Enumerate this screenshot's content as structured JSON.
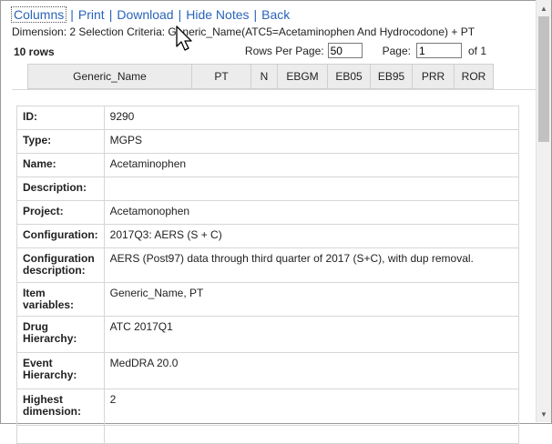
{
  "toolbar": {
    "columns": "Columns",
    "print": "Print",
    "download": "Download",
    "hide_notes": "Hide Notes",
    "back": "Back",
    "separator": "|"
  },
  "criteria": "Dimension: 2 Selection Criteria: Generic_Name(ATC5=Acetaminophen And Hydrocodone) + PT",
  "rows_count": "10 rows",
  "pager": {
    "rows_per_page_label": "Rows Per Page:",
    "rows_per_page_value": "50",
    "page_label": "Page:",
    "page_value": "1",
    "of_label": "of 1"
  },
  "columns": [
    "Generic_Name",
    "PT",
    "N",
    "EBGM",
    "EB05",
    "EB95",
    "PRR",
    "ROR"
  ],
  "details": [
    {
      "key": "ID:",
      "value": "9290"
    },
    {
      "key": "Type:",
      "value": "MGPS"
    },
    {
      "key": "Name:",
      "value": "Acetaminophen"
    },
    {
      "key": "Description:",
      "value": ""
    },
    {
      "key": "Project:",
      "value": "Acetamonophen"
    },
    {
      "key": "Configuration:",
      "value": "2017Q3: AERS (S + C)"
    },
    {
      "key": "Configuration description:",
      "value": "AERS (Post97) data through third quarter of 2017 (S+C), with dup removal."
    },
    {
      "key": "Item variables:",
      "value": "Generic_Name, PT"
    },
    {
      "key": "Drug Hierarchy:",
      "value": "ATC 2017Q1"
    },
    {
      "key": "Event Hierarchy:",
      "value": "MedDRA 20.0"
    },
    {
      "key": "Highest dimension:",
      "value": "2"
    },
    {
      "key": "",
      "value": ""
    }
  ],
  "colors": {
    "link": "#2a64b8",
    "header_bg": "#ececec",
    "border": "#d6d6d6"
  },
  "icons": [
    "mouse-pointer-icon",
    "scroll-up-icon",
    "scroll-down-icon"
  ]
}
